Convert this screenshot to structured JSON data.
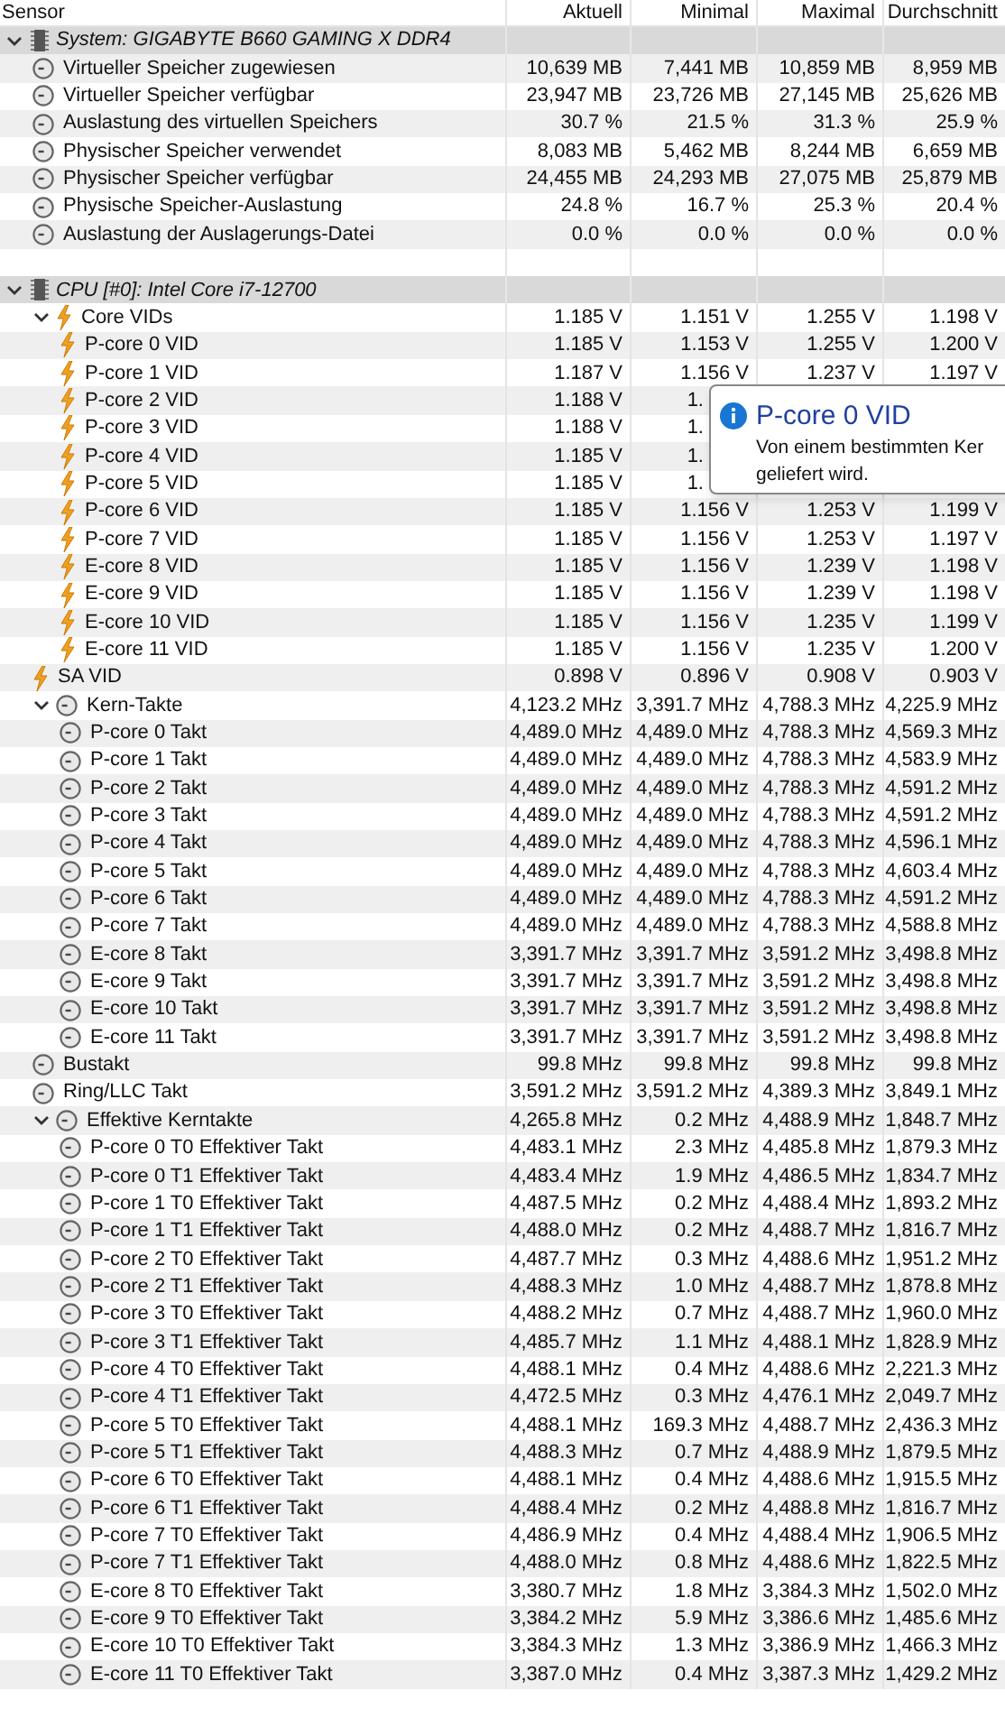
{
  "columns": [
    "Sensor",
    "Aktuell",
    "Minimal",
    "Maximal",
    "Durchschnitt"
  ],
  "sections": [
    {
      "title": "System: GIGABYTE B660 GAMING X DDR4",
      "expanded": true,
      "rows": [
        {
          "kind": "clock",
          "label": "Virtueller Speicher zugewiesen",
          "values": [
            "10,639 MB",
            "7,441 MB",
            "10,859 MB",
            "8,959 MB"
          ]
        },
        {
          "kind": "clock",
          "label": "Virtueller Speicher verfügbar",
          "values": [
            "23,947 MB",
            "23,726 MB",
            "27,145 MB",
            "25,626 MB"
          ]
        },
        {
          "kind": "clock",
          "label": "Auslastung des virtuellen Speichers",
          "values": [
            "30.7 %",
            "21.5 %",
            "31.3 %",
            "25.9 %"
          ]
        },
        {
          "kind": "clock",
          "label": "Physischer Speicher verwendet",
          "values": [
            "8,083 MB",
            "5,462 MB",
            "8,244 MB",
            "6,659 MB"
          ]
        },
        {
          "kind": "clock",
          "label": "Physischer Speicher verfügbar",
          "values": [
            "24,455 MB",
            "24,293 MB",
            "27,075 MB",
            "25,879 MB"
          ]
        },
        {
          "kind": "clock",
          "label": "Physische Speicher-Auslastung",
          "values": [
            "24.8 %",
            "16.7 %",
            "25.3 %",
            "20.4 %"
          ]
        },
        {
          "kind": "clock",
          "label": "Auslastung der Auslagerungs-Datei",
          "values": [
            "0.0 %",
            "0.0 %",
            "0.0 %",
            "0.0 %"
          ]
        }
      ]
    },
    {
      "title": "CPU [#0]: Intel Core i7-12700",
      "expanded": true,
      "rows": [
        {
          "kind": "bolt",
          "label": "Core VIDs",
          "values": [
            "1.185 V",
            "1.151 V",
            "1.255 V",
            "1.198 V"
          ],
          "expanded": true,
          "children": [
            {
              "kind": "bolt",
              "label": "P-core 0 VID",
              "values": [
                "1.185 V",
                "1.153 V",
                "1.255 V",
                "1.200 V"
              ]
            },
            {
              "kind": "bolt",
              "label": "P-core 1 VID",
              "values": [
                "1.187 V",
                "1.156 V",
                "1.237 V",
                "1.197 V"
              ]
            },
            {
              "kind": "bolt",
              "label": "P-core 2 VID",
              "values": [
                "1.188 V",
                "1."
              ]
            },
            {
              "kind": "bolt",
              "label": "P-core 3 VID",
              "values": [
                "1.188 V",
                "1."
              ]
            },
            {
              "kind": "bolt",
              "label": "P-core 4 VID",
              "values": [
                "1.185 V",
                "1."
              ]
            },
            {
              "kind": "bolt",
              "label": "P-core 5 VID",
              "values": [
                "1.185 V",
                "1."
              ]
            },
            {
              "kind": "bolt",
              "label": "P-core 6 VID",
              "values": [
                "1.185 V",
                "1.156 V",
                "1.253 V",
                "1.199 V"
              ]
            },
            {
              "kind": "bolt",
              "label": "P-core 7 VID",
              "values": [
                "1.185 V",
                "1.156 V",
                "1.253 V",
                "1.197 V"
              ]
            },
            {
              "kind": "bolt",
              "label": "E-core 8 VID",
              "values": [
                "1.185 V",
                "1.156 V",
                "1.239 V",
                "1.198 V"
              ]
            },
            {
              "kind": "bolt",
              "label": "E-core 9 VID",
              "values": [
                "1.185 V",
                "1.156 V",
                "1.239 V",
                "1.198 V"
              ]
            },
            {
              "kind": "bolt",
              "label": "E-core 10 VID",
              "values": [
                "1.185 V",
                "1.156 V",
                "1.235 V",
                "1.199 V"
              ]
            },
            {
              "kind": "bolt",
              "label": "E-core 11 VID",
              "values": [
                "1.185 V",
                "1.156 V",
                "1.235 V",
                "1.200 V"
              ]
            }
          ]
        },
        {
          "kind": "bolt",
          "label": "SA VID",
          "values": [
            "0.898 V",
            "0.896 V",
            "0.908 V",
            "0.903 V"
          ]
        },
        {
          "kind": "clock",
          "label": "Kern-Takte",
          "values": [
            "4,123.2 MHz",
            "3,391.7 MHz",
            "4,788.3 MHz",
            "4,225.9 MHz"
          ],
          "expanded": true,
          "children": [
            {
              "kind": "clock",
              "label": "P-core 0 Takt",
              "values": [
                "4,489.0 MHz",
                "4,489.0 MHz",
                "4,788.3 MHz",
                "4,569.3 MHz"
              ]
            },
            {
              "kind": "clock",
              "label": "P-core 1 Takt",
              "values": [
                "4,489.0 MHz",
                "4,489.0 MHz",
                "4,788.3 MHz",
                "4,583.9 MHz"
              ]
            },
            {
              "kind": "clock",
              "label": "P-core 2 Takt",
              "values": [
                "4,489.0 MHz",
                "4,489.0 MHz",
                "4,788.3 MHz",
                "4,591.2 MHz"
              ]
            },
            {
              "kind": "clock",
              "label": "P-core 3 Takt",
              "values": [
                "4,489.0 MHz",
                "4,489.0 MHz",
                "4,788.3 MHz",
                "4,591.2 MHz"
              ]
            },
            {
              "kind": "clock",
              "label": "P-core 4 Takt",
              "values": [
                "4,489.0 MHz",
                "4,489.0 MHz",
                "4,788.3 MHz",
                "4,596.1 MHz"
              ]
            },
            {
              "kind": "clock",
              "label": "P-core 5 Takt",
              "values": [
                "4,489.0 MHz",
                "4,489.0 MHz",
                "4,788.3 MHz",
                "4,603.4 MHz"
              ]
            },
            {
              "kind": "clock",
              "label": "P-core 6 Takt",
              "values": [
                "4,489.0 MHz",
                "4,489.0 MHz",
                "4,788.3 MHz",
                "4,591.2 MHz"
              ]
            },
            {
              "kind": "clock",
              "label": "P-core 7 Takt",
              "values": [
                "4,489.0 MHz",
                "4,489.0 MHz",
                "4,788.3 MHz",
                "4,588.8 MHz"
              ]
            },
            {
              "kind": "clock",
              "label": "E-core 8 Takt",
              "values": [
                "3,391.7 MHz",
                "3,391.7 MHz",
                "3,591.2 MHz",
                "3,498.8 MHz"
              ]
            },
            {
              "kind": "clock",
              "label": "E-core 9 Takt",
              "values": [
                "3,391.7 MHz",
                "3,391.7 MHz",
                "3,591.2 MHz",
                "3,498.8 MHz"
              ]
            },
            {
              "kind": "clock",
              "label": "E-core 10 Takt",
              "values": [
                "3,391.7 MHz",
                "3,391.7 MHz",
                "3,591.2 MHz",
                "3,498.8 MHz"
              ]
            },
            {
              "kind": "clock",
              "label": "E-core 11 Takt",
              "values": [
                "3,391.7 MHz",
                "3,391.7 MHz",
                "3,591.2 MHz",
                "3,498.8 MHz"
              ]
            }
          ]
        },
        {
          "kind": "clock",
          "label": "Bustakt",
          "values": [
            "99.8 MHz",
            "99.8 MHz",
            "99.8 MHz",
            "99.8 MHz"
          ]
        },
        {
          "kind": "clock",
          "label": "Ring/LLC Takt",
          "values": [
            "3,591.2 MHz",
            "3,591.2 MHz",
            "4,389.3 MHz",
            "3,849.1 MHz"
          ]
        },
        {
          "kind": "clock",
          "label": "Effektive Kerntakte",
          "values": [
            "4,265.8 MHz",
            "0.2 MHz",
            "4,488.9 MHz",
            "1,848.7 MHz"
          ],
          "expanded": true,
          "children": [
            {
              "kind": "clock",
              "label": "P-core 0 T0 Effektiver Takt",
              "values": [
                "4,483.1 MHz",
                "2.3 MHz",
                "4,485.8 MHz",
                "1,879.3 MHz"
              ]
            },
            {
              "kind": "clock",
              "label": "P-core 0 T1 Effektiver Takt",
              "values": [
                "4,483.4 MHz",
                "1.9 MHz",
                "4,486.5 MHz",
                "1,834.7 MHz"
              ]
            },
            {
              "kind": "clock",
              "label": "P-core 1 T0 Effektiver Takt",
              "values": [
                "4,487.5 MHz",
                "0.2 MHz",
                "4,488.4 MHz",
                "1,893.2 MHz"
              ]
            },
            {
              "kind": "clock",
              "label": "P-core 1 T1 Effektiver Takt",
              "values": [
                "4,488.0 MHz",
                "0.2 MHz",
                "4,488.7 MHz",
                "1,816.7 MHz"
              ]
            },
            {
              "kind": "clock",
              "label": "P-core 2 T0 Effektiver Takt",
              "values": [
                "4,487.7 MHz",
                "0.3 MHz",
                "4,488.6 MHz",
                "1,951.2 MHz"
              ]
            },
            {
              "kind": "clock",
              "label": "P-core 2 T1 Effektiver Takt",
              "values": [
                "4,488.3 MHz",
                "1.0 MHz",
                "4,488.7 MHz",
                "1,878.8 MHz"
              ]
            },
            {
              "kind": "clock",
              "label": "P-core 3 T0 Effektiver Takt",
              "values": [
                "4,488.2 MHz",
                "0.7 MHz",
                "4,488.7 MHz",
                "1,960.0 MHz"
              ]
            },
            {
              "kind": "clock",
              "label": "P-core 3 T1 Effektiver Takt",
              "values": [
                "4,485.7 MHz",
                "1.1 MHz",
                "4,488.1 MHz",
                "1,828.9 MHz"
              ]
            },
            {
              "kind": "clock",
              "label": "P-core 4 T0 Effektiver Takt",
              "values": [
                "4,488.1 MHz",
                "0.4 MHz",
                "4,488.6 MHz",
                "2,221.3 MHz"
              ]
            },
            {
              "kind": "clock",
              "label": "P-core 4 T1 Effektiver Takt",
              "values": [
                "4,472.5 MHz",
                "0.3 MHz",
                "4,476.1 MHz",
                "2,049.7 MHz"
              ]
            },
            {
              "kind": "clock",
              "label": "P-core 5 T0 Effektiver Takt",
              "values": [
                "4,488.1 MHz",
                "169.3 MHz",
                "4,488.7 MHz",
                "2,436.3 MHz"
              ]
            },
            {
              "kind": "clock",
              "label": "P-core 5 T1 Effektiver Takt",
              "values": [
                "4,488.3 MHz",
                "0.7 MHz",
                "4,488.9 MHz",
                "1,879.5 MHz"
              ]
            },
            {
              "kind": "clock",
              "label": "P-core 6 T0 Effektiver Takt",
              "values": [
                "4,488.1 MHz",
                "0.4 MHz",
                "4,488.6 MHz",
                "1,915.5 MHz"
              ]
            },
            {
              "kind": "clock",
              "label": "P-core 6 T1 Effektiver Takt",
              "values": [
                "4,488.4 MHz",
                "0.2 MHz",
                "4,488.8 MHz",
                "1,816.7 MHz"
              ]
            },
            {
              "kind": "clock",
              "label": "P-core 7 T0 Effektiver Takt",
              "values": [
                "4,486.9 MHz",
                "0.4 MHz",
                "4,488.4 MHz",
                "1,906.5 MHz"
              ]
            },
            {
              "kind": "clock",
              "label": "P-core 7 T1 Effektiver Takt",
              "values": [
                "4,488.0 MHz",
                "0.8 MHz",
                "4,488.6 MHz",
                "1,822.5 MHz"
              ]
            },
            {
              "kind": "clock",
              "label": "E-core 8 T0 Effektiver Takt",
              "values": [
                "3,380.7 MHz",
                "1.8 MHz",
                "3,384.3 MHz",
                "1,502.0 MHz"
              ]
            },
            {
              "kind": "clock",
              "label": "E-core 9 T0 Effektiver Takt",
              "values": [
                "3,384.2 MHz",
                "5.9 MHz",
                "3,386.6 MHz",
                "1,485.6 MHz"
              ]
            },
            {
              "kind": "clock",
              "label": "E-core 10 T0 Effektiver Takt",
              "values": [
                "3,384.3 MHz",
                "1.3 MHz",
                "3,386.9 MHz",
                "1,466.3 MHz"
              ]
            },
            {
              "kind": "clock",
              "label": "E-core 11 T0 Effektiver Takt",
              "values": [
                "3,387.0 MHz",
                "0.4 MHz",
                "3,387.3 MHz",
                "1,429.2 MHz"
              ]
            }
          ]
        }
      ]
    }
  ],
  "tooltip": {
    "title": "P-core 0 VID",
    "lines": [
      "Von einem bestimmten Ker",
      "geliefert wird."
    ]
  }
}
